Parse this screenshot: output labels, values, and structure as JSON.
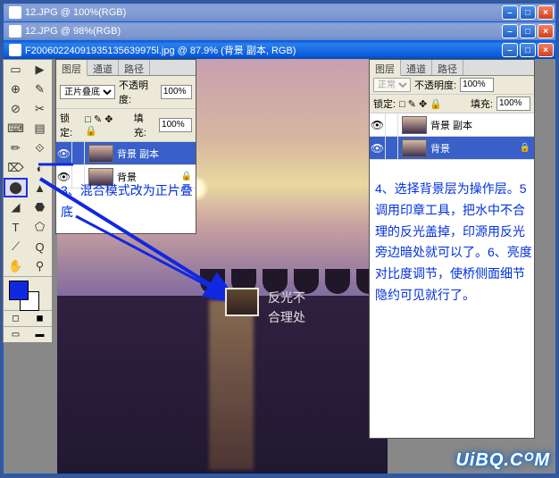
{
  "windows": {
    "w1": {
      "title": "12.JPG @ 100%(RGB)"
    },
    "w2": {
      "title": "12.JPG @ 98%(RGB)"
    },
    "w3": {
      "title": "F20060224091935135639975l.jpg @ 87.9% (背景 副本, RGB)"
    }
  },
  "buttons": {
    "min": "–",
    "max": "□",
    "close": "×"
  },
  "tools": {
    "items": [
      "▭",
      "▶",
      "⊕",
      "✎",
      "⊘",
      "✂",
      "⌨",
      "▤",
      "✏",
      "⟐",
      "⌦",
      "◐",
      "⬤",
      "▲",
      "◢",
      "⬣",
      "T",
      "⬠",
      "⟋",
      "Q",
      "✋",
      "⚲"
    ],
    "selected_index": 12,
    "selected_name": "clone-stamp"
  },
  "panels": {
    "tabs": [
      "图层",
      "通道",
      "路径"
    ],
    "active_tab": 0,
    "opacity_label": "不透明度:",
    "fill_label": "填充:",
    "lock_label": "锁定:",
    "left": {
      "blend_mode": "正片叠底",
      "opacity": "100%",
      "fill": "100%",
      "lock_icons": "□ ✎ ✥ 🔒",
      "layers": [
        {
          "name": "背景 副本",
          "selected": true,
          "locked": false
        },
        {
          "name": "背景",
          "selected": false,
          "locked": true
        }
      ]
    },
    "right": {
      "blend_mode": "正常",
      "opacity": "100%",
      "fill": "100%",
      "lock_icons": "□ ✎ ✥ 🔒",
      "layers": [
        {
          "name": "背景 副本",
          "selected": false,
          "locked": false
        },
        {
          "name": "背景",
          "selected": true,
          "locked": true
        }
      ]
    }
  },
  "annotations": {
    "left": "3、混合模式改为正片叠底",
    "right": "4、选择背景层为操作层。5 调用印章工具，把水中不合理的反光盖掉，印源用反光旁边暗处就可以了。6、亮度对比度调节，使桥侧面细节隐约可见就行了。",
    "thumb_caption": "反光不\n合理处"
  },
  "watermark": "UiBQ.CᴼM",
  "icons": {
    "eye": "👁",
    "lock": "🔒"
  }
}
